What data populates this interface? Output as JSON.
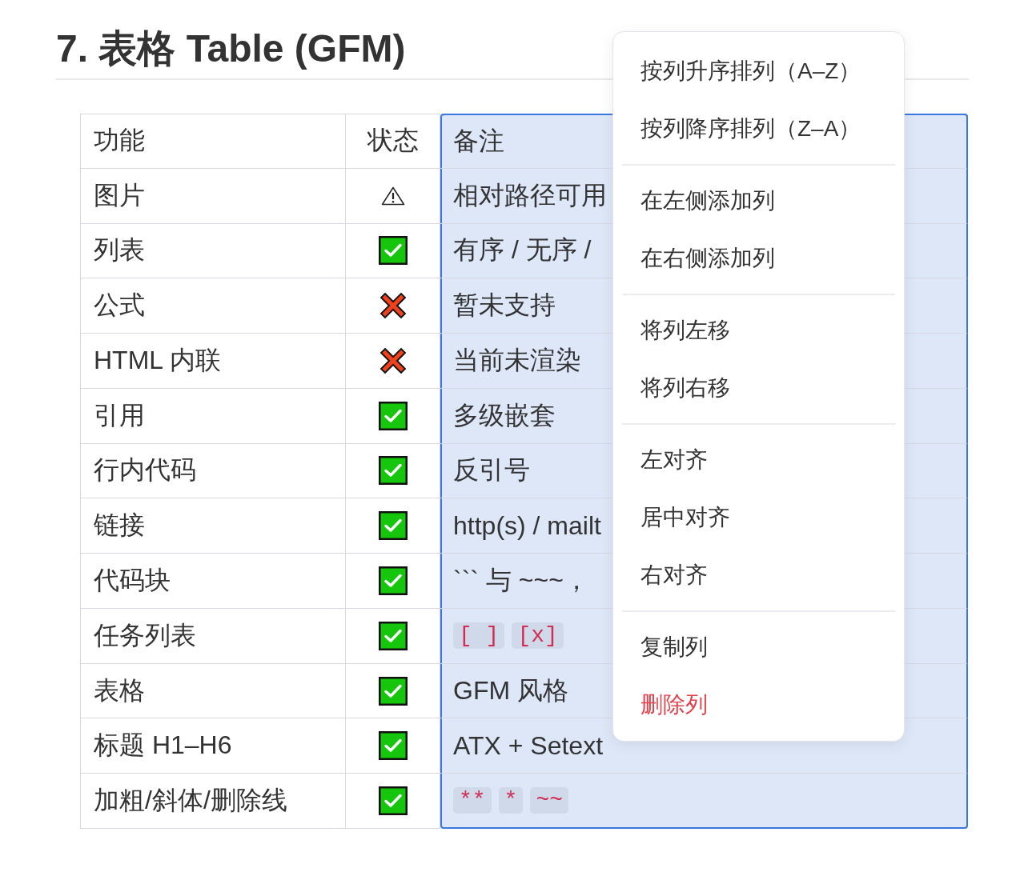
{
  "heading": "7. 表格 Table (GFM)",
  "table": {
    "columns": [
      {
        "label": "功能",
        "selected": false
      },
      {
        "label": "状态",
        "selected": false
      },
      {
        "label": "备注",
        "selected": true
      }
    ],
    "rows": [
      {
        "feature": "图片",
        "status": {
          "kind": "warning"
        },
        "note": {
          "kind": "text",
          "text": "相对路径可用"
        }
      },
      {
        "feature": "列表",
        "status": {
          "kind": "check"
        },
        "note": {
          "kind": "text",
          "text": "有序 / 无序 /"
        }
      },
      {
        "feature": "公式",
        "status": {
          "kind": "cross"
        },
        "note": {
          "kind": "text",
          "text": "暂未支持"
        }
      },
      {
        "feature": "HTML 内联",
        "status": {
          "kind": "cross"
        },
        "note": {
          "kind": "text",
          "text": "当前未渲染"
        }
      },
      {
        "feature": "引用",
        "status": {
          "kind": "check"
        },
        "note": {
          "kind": "text",
          "text": "多级嵌套"
        }
      },
      {
        "feature": "行内代码",
        "status": {
          "kind": "check"
        },
        "note": {
          "kind": "text",
          "text": "反引号"
        }
      },
      {
        "feature": "链接",
        "status": {
          "kind": "check"
        },
        "note": {
          "kind": "text",
          "text": "http(s) / mailt"
        }
      },
      {
        "feature": "代码块",
        "status": {
          "kind": "check"
        },
        "note": {
          "kind": "text",
          "text": "``` 与 ~~~，"
        }
      },
      {
        "feature": "任务列表",
        "status": {
          "kind": "check"
        },
        "note": {
          "kind": "code",
          "chips": [
            "[ ]",
            "[x]"
          ]
        }
      },
      {
        "feature": "表格",
        "status": {
          "kind": "check"
        },
        "note": {
          "kind": "text",
          "text": "GFM 风格"
        }
      },
      {
        "feature": "标题 H1–H6",
        "status": {
          "kind": "check"
        },
        "note": {
          "kind": "text",
          "text": "ATX + Setext"
        }
      },
      {
        "feature": "加粗/斜体/删除线",
        "status": {
          "kind": "check"
        },
        "note": {
          "kind": "code",
          "chips": [
            "**",
            "*",
            "~~"
          ]
        }
      }
    ]
  },
  "context_menu": {
    "groups": [
      {
        "items": [
          {
            "label": "按列升序排列（A–Z）",
            "kind": "normal"
          },
          {
            "label": "按列降序排列（Z–A）",
            "kind": "normal"
          }
        ]
      },
      {
        "items": [
          {
            "label": "在左侧添加列",
            "kind": "normal"
          },
          {
            "label": "在右侧添加列",
            "kind": "normal"
          }
        ]
      },
      {
        "items": [
          {
            "label": "将列左移",
            "kind": "normal"
          },
          {
            "label": "将列右移",
            "kind": "normal"
          }
        ]
      },
      {
        "items": [
          {
            "label": "左对齐",
            "kind": "normal"
          },
          {
            "label": "居中对齐",
            "kind": "normal"
          },
          {
            "label": "右对齐",
            "kind": "normal"
          }
        ]
      },
      {
        "items": [
          {
            "label": "复制列",
            "kind": "normal"
          },
          {
            "label": "删除列",
            "kind": "danger"
          }
        ]
      }
    ]
  }
}
